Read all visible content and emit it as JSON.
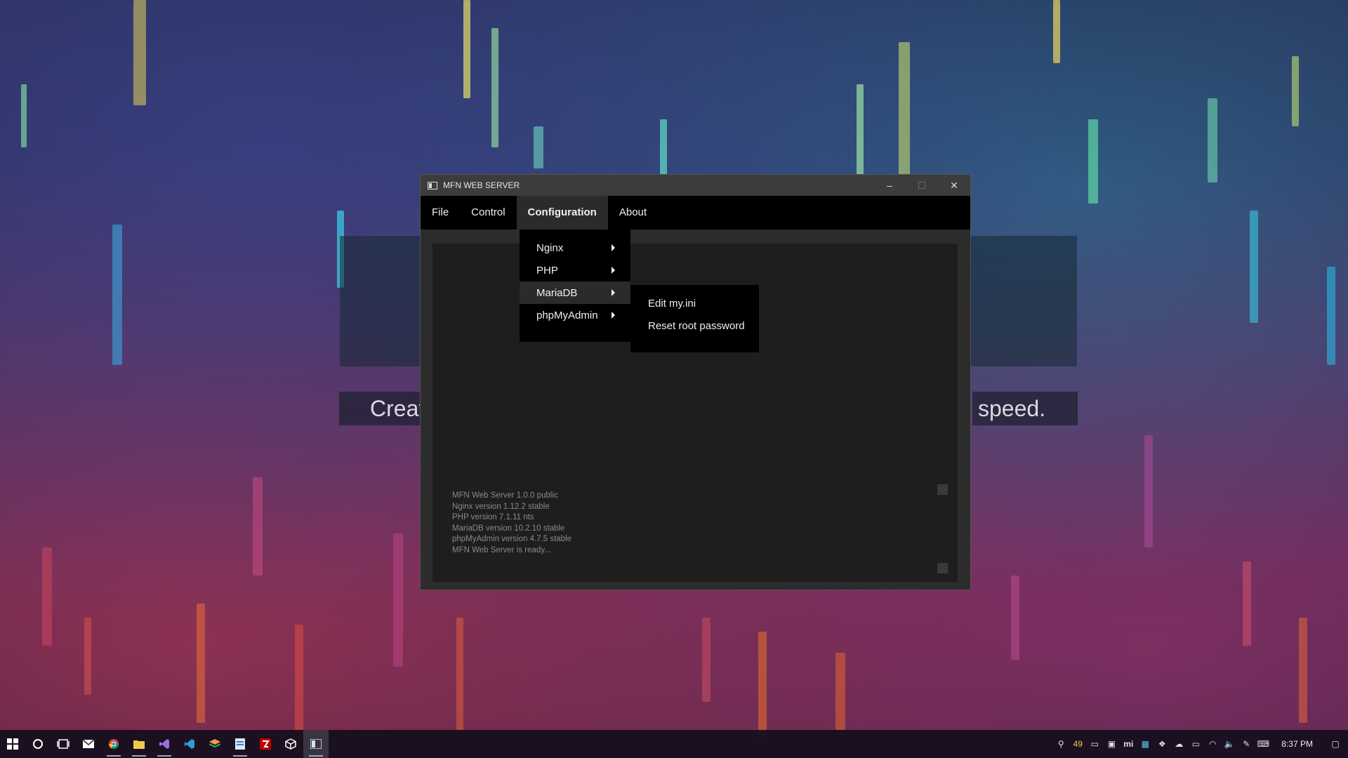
{
  "desktop": {
    "caption_left": "Creat",
    "caption_right": "speed."
  },
  "window": {
    "title": "MFN WEB SERVER",
    "controls": {
      "minimize": "–",
      "maximize": "☐",
      "close": "✕"
    }
  },
  "menubar": {
    "items": [
      {
        "label": "File"
      },
      {
        "label": "Control"
      },
      {
        "label": "Configuration"
      },
      {
        "label": "About"
      }
    ]
  },
  "dropdown": {
    "items": [
      {
        "label": "Nginx"
      },
      {
        "label": "PHP"
      },
      {
        "label": "MariaDB"
      },
      {
        "label": "phpMyAdmin"
      }
    ]
  },
  "submenu": {
    "items": [
      {
        "label": "Edit my.ini"
      },
      {
        "label": "Reset root password"
      }
    ]
  },
  "log": {
    "lines": [
      "MFN Web Server 1.0.0 public",
      "Nginx version 1.12.2 stable",
      "PHP version 7.1.11 nts",
      "MariaDB version 10.2.10 stable",
      "phpMyAdmin version 4.7.5 stable",
      "MFN Web Server is ready..."
    ]
  },
  "taskbar": {
    "badge": "49",
    "tray_text": "mi",
    "time": "8:37 PM"
  },
  "colors": {
    "menubar_bg": "#000000",
    "active_item_bg": "#2b2b2b",
    "content_bg": "#1e1e1e",
    "log_text": "#8a8a8a"
  }
}
